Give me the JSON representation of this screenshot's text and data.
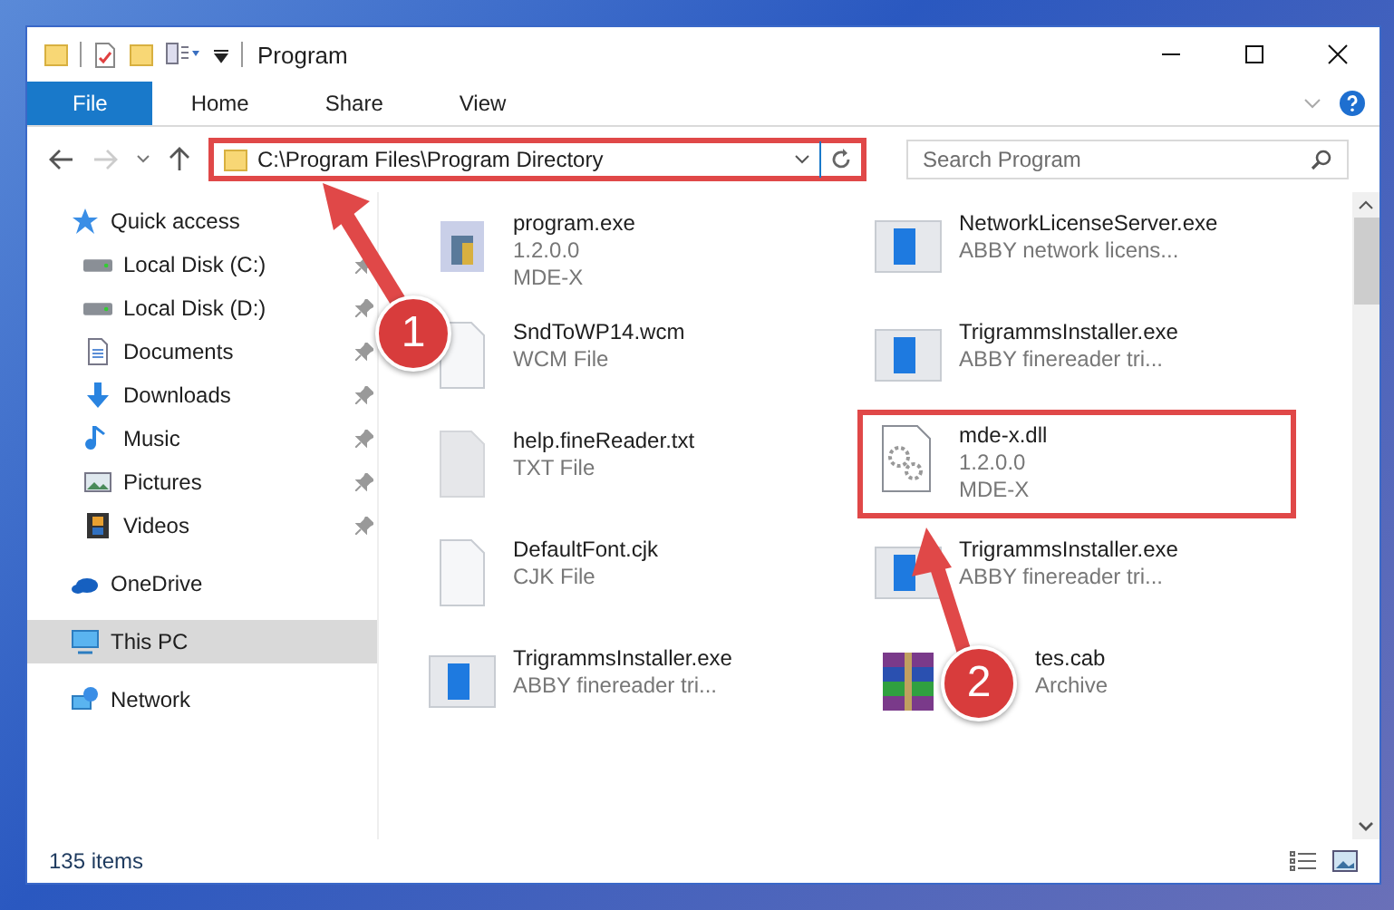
{
  "window": {
    "title": "Program"
  },
  "ribbon_tabs": [
    {
      "label": "File",
      "selected": true
    },
    {
      "label": "Home",
      "selected": false
    },
    {
      "label": "Share",
      "selected": false
    },
    {
      "label": "View",
      "selected": false
    }
  ],
  "address": {
    "value": "C:\\Program Files\\Program Directory",
    "highlighted": true
  },
  "search": {
    "placeholder": "Search Program"
  },
  "sidebar": {
    "items": [
      {
        "label": "Quick access",
        "kind": "star",
        "selected": false,
        "children": [
          {
            "label": "Local Disk (C:)",
            "kind": "disk",
            "pinned": true,
            "selected": false
          },
          {
            "label": "Local Disk (D:)",
            "kind": "disk",
            "pinned": true,
            "selected": false
          },
          {
            "label": "Documents",
            "kind": "doc",
            "pinned": true,
            "selected": false
          },
          {
            "label": "Downloads",
            "kind": "download",
            "pinned": true,
            "selected": false
          },
          {
            "label": "Music",
            "kind": "music",
            "pinned": true,
            "selected": false
          },
          {
            "label": "Pictures",
            "kind": "pictures",
            "pinned": true,
            "selected": false
          },
          {
            "label": "Videos",
            "kind": "video",
            "pinned": true,
            "selected": false
          }
        ]
      },
      {
        "label": "OneDrive",
        "kind": "cloud",
        "selected": false
      },
      {
        "label": "This PC",
        "kind": "pc",
        "selected": true
      },
      {
        "label": "Network",
        "kind": "network",
        "selected": false
      }
    ]
  },
  "files": [
    {
      "name": "program.exe",
      "details": [
        "1.2.0.0",
        "MDE-X"
      ],
      "kind": "setup",
      "highlighted": false
    },
    {
      "name": "NetworkLicenseServer.exe",
      "details": [
        "ABBY network licens..."
      ],
      "kind": "app",
      "highlighted": false
    },
    {
      "name": "SndToWP14.wcm",
      "details": [
        "WCM File"
      ],
      "kind": "blank",
      "highlighted": false
    },
    {
      "name": "TrigrammsInstaller.exe",
      "details": [
        "ABBY finereader tri..."
      ],
      "kind": "app",
      "highlighted": false
    },
    {
      "name": "help.fineReader.txt",
      "details": [
        "TXT File"
      ],
      "kind": "grey",
      "highlighted": false
    },
    {
      "name": "mde-x.dll",
      "details": [
        "1.2.0.0",
        "MDE-X"
      ],
      "kind": "gear",
      "highlighted": true
    },
    {
      "name": "DefaultFont.cjk",
      "details": [
        "CJK File"
      ],
      "kind": "blank",
      "highlighted": false
    },
    {
      "name": "TrigrammsInstaller.exe",
      "details": [
        "ABBY finereader tri..."
      ],
      "kind": "app",
      "highlighted": false
    },
    {
      "name": "TrigrammsInstaller.exe",
      "details": [
        "ABBY finereader tri..."
      ],
      "kind": "app",
      "highlighted": false
    },
    {
      "name": "tes.cab",
      "details": [
        "Archive"
      ],
      "kind": "archive",
      "highlighted": false
    }
  ],
  "annotations": [
    {
      "label": "1"
    },
    {
      "label": "2"
    }
  ],
  "status_bar": {
    "count": "135 items"
  }
}
